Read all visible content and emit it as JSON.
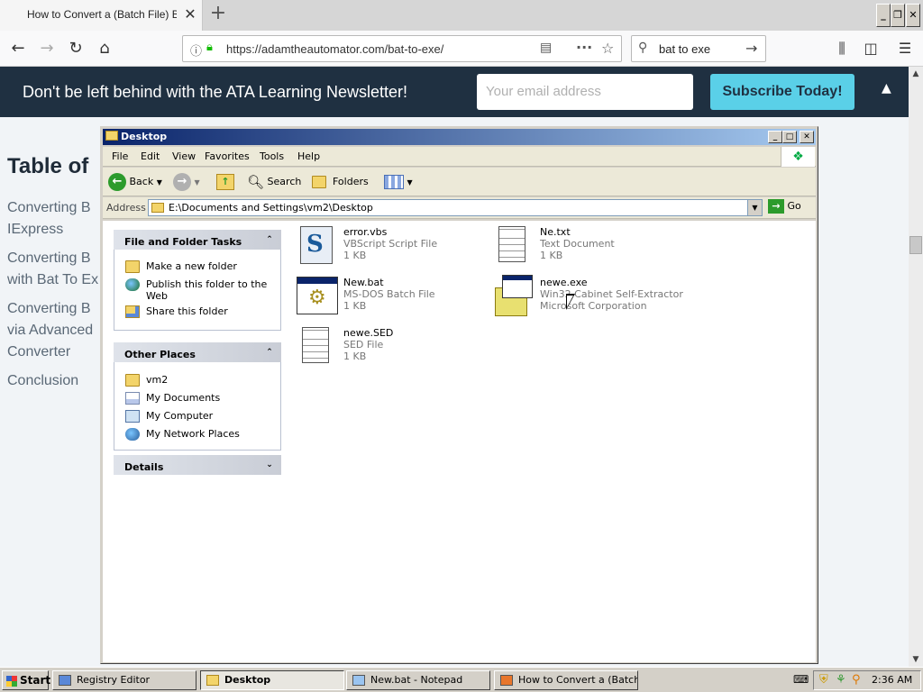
{
  "browser": {
    "tab_title": "How to Convert a (Batch File) BAT",
    "tab_close": "✕",
    "new_tab": "+",
    "url": "https://adamtheautomator.com/bat-to-exe/",
    "search_query": "bat to exe",
    "window_buttons": {
      "minimize": "_",
      "restore": "❐",
      "close": "✕"
    }
  },
  "webpage": {
    "newsletter_text": "Don't be left behind with the ATA Learning Newsletter!",
    "email_placeholder": "Your email address",
    "subscribe_label": "Subscribe Today!",
    "toc_title": "Table of",
    "toc_items": [
      {
        "line1": "Converting B",
        "line2": "IExpress"
      },
      {
        "line1": "Converting B",
        "line2": "with Bat To Ex"
      },
      {
        "line1": "Converting B",
        "line2": "via Advanced",
        "line3": "Converter"
      },
      {
        "line1": "Conclusion"
      }
    ]
  },
  "explorer": {
    "title": "Desktop",
    "menu": [
      "File",
      "Edit",
      "View",
      "Favorites",
      "Tools",
      "Help"
    ],
    "toolbar": {
      "back": "Back",
      "search": "Search",
      "folders": "Folders"
    },
    "address_label": "Address",
    "address_path": "E:\\Documents and Settings\\vm2\\Desktop",
    "go_label": "Go",
    "tasks_header": "File and Folder Tasks",
    "tasks": [
      "Make a new folder",
      "Publish this folder to the",
      "Web",
      "Share this folder"
    ],
    "other_places_header": "Other Places",
    "other_places": [
      "vm2",
      "My Documents",
      "My Computer",
      "My Network Places"
    ],
    "details_header": "Details",
    "files": [
      {
        "name": "error.vbs",
        "type": "VBScript Script File",
        "size": "1 KB",
        "icon": "vbscript-file-icon"
      },
      {
        "name": "Ne.txt",
        "type": "Text Document",
        "size": "1 KB",
        "icon": "text-document-icon"
      },
      {
        "name": "New.bat",
        "type": "MS-DOS Batch File",
        "size": "1 KB",
        "icon": "batch-file-icon"
      },
      {
        "name": "newe.exe",
        "type": "Win32 Cabinet Self-Extractor",
        "size": "Microsoft Corporation",
        "icon": "cabinet-exe-icon"
      },
      {
        "name": "newe.SED",
        "type": "SED File",
        "size": "1 KB",
        "icon": "sed-file-icon"
      }
    ]
  },
  "taskbar": {
    "start": "Start",
    "items": [
      "Registry Editor",
      "Desktop",
      "New.bat - Notepad",
      "How to Convert a (Batch..."
    ],
    "clock": "2:36 AM"
  },
  "colors": {
    "newsletter_bg": "#1f3041",
    "subscribe_bg": "#5ad0e8",
    "xp_title_start": "#0a246a",
    "xp_title_end": "#a6caf0"
  }
}
